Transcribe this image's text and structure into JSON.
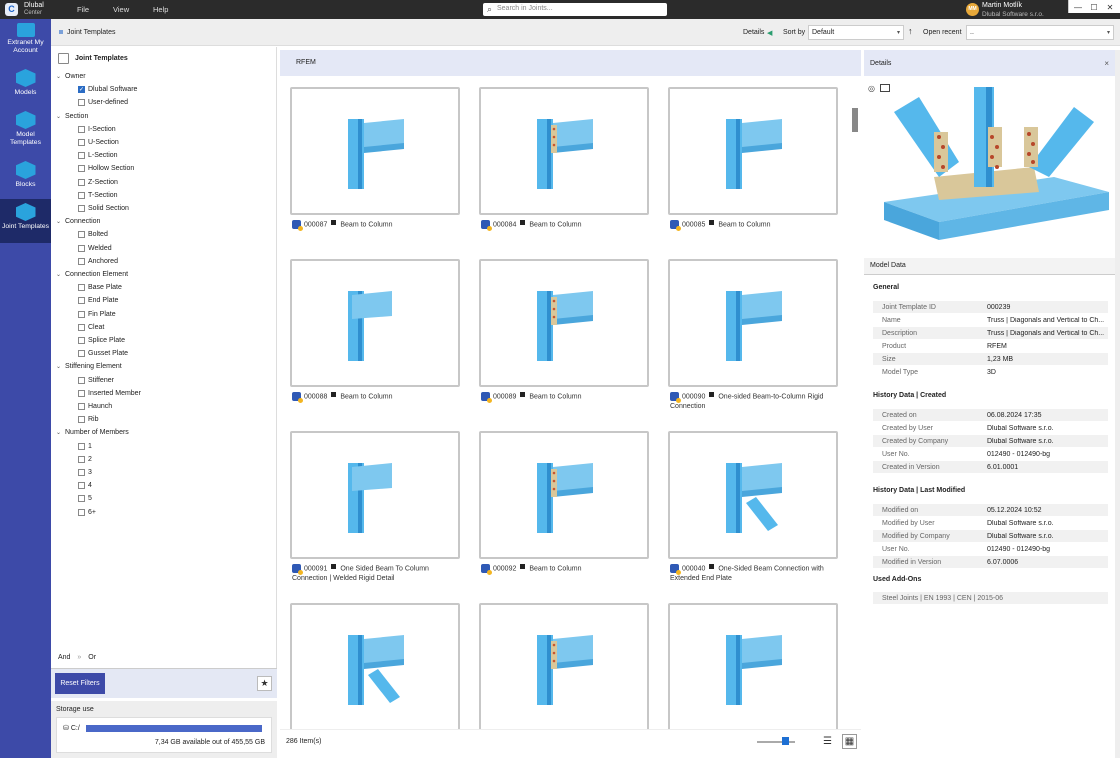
{
  "app": {
    "brand_top": "Dlubal",
    "brand_sub": "Center",
    "logo": "C"
  },
  "menu": [
    "File",
    "View",
    "Help"
  ],
  "search": {
    "placeholder": "Search in Joints..."
  },
  "user": {
    "initials": "MM",
    "name": "Martin Motlík",
    "company": "Dlubal Software s.r.o."
  },
  "window_controls": {
    "minimize": "—",
    "maximize": "☐",
    "close": "✕"
  },
  "nav": [
    {
      "label": "Extranet My Account",
      "icon": "extranet-icon"
    },
    {
      "label": "Models",
      "icon": "models-icon"
    },
    {
      "label": "Model Templates",
      "icon": "model-templates-icon"
    },
    {
      "label": "Blocks",
      "icon": "blocks-icon"
    },
    {
      "label": "Joint Templates",
      "icon": "joint-templates-icon",
      "selected": true
    }
  ],
  "toolbar": {
    "breadcrumb": "Joint Templates",
    "details_label": "Details",
    "sort_label": "Sort by",
    "sort_value": "Default",
    "open_recent_label": "Open recent",
    "open_recent_value": "..",
    "sort_dir_icon": "↑",
    "details_flag": "◀"
  },
  "filters": {
    "title": "Joint Templates",
    "groups": [
      {
        "label": "Owner",
        "items": [
          {
            "label": "Dlubal Software",
            "checked": true
          },
          {
            "label": "User-defined",
            "checked": false
          }
        ]
      },
      {
        "label": "Section",
        "items": [
          {
            "label": "I-Section"
          },
          {
            "label": "U-Section"
          },
          {
            "label": "L-Section"
          },
          {
            "label": "Hollow Section"
          },
          {
            "label": "Z-Section"
          },
          {
            "label": "T-Section"
          },
          {
            "label": "Solid Section"
          }
        ]
      },
      {
        "label": "Connection",
        "items": [
          {
            "label": "Bolted"
          },
          {
            "label": "Welded"
          },
          {
            "label": "Anchored"
          }
        ]
      },
      {
        "label": "Connection Element",
        "items": [
          {
            "label": "Base Plate"
          },
          {
            "label": "End Plate"
          },
          {
            "label": "Fin Plate"
          },
          {
            "label": "Cleat"
          },
          {
            "label": "Splice Plate"
          },
          {
            "label": "Gusset Plate"
          }
        ]
      },
      {
        "label": "Stiffening Element",
        "items": [
          {
            "label": "Stiffener"
          },
          {
            "label": "Inserted Member"
          },
          {
            "label": "Haunch"
          },
          {
            "label": "Rib"
          }
        ]
      },
      {
        "label": "Number of Members",
        "items": [
          {
            "label": "1"
          },
          {
            "label": "2"
          },
          {
            "label": "3"
          },
          {
            "label": "4"
          },
          {
            "label": "5"
          },
          {
            "label": "6+"
          }
        ]
      }
    ],
    "and_label": "And",
    "or_label": "Or",
    "reset_label": "Reset Filters"
  },
  "storage": {
    "title": "Storage use",
    "drive": "C:/",
    "available": "7,34 GB available out of 455,55 GB",
    "used_fraction": 0.984
  },
  "grid": {
    "header": "RFEM",
    "count": "286 Item(s)",
    "items": [
      {
        "id": "000087",
        "name": "Beam to Column"
      },
      {
        "id": "000084",
        "name": "Beam to Column"
      },
      {
        "id": "000085",
        "name": "Beam to Column"
      },
      {
        "id": "000088",
        "name": "Beam to Column"
      },
      {
        "id": "000089",
        "name": "Beam to Column"
      },
      {
        "id": "000090",
        "name": "One-sided Beam-to-Column Rigid Connection"
      },
      {
        "id": "000091",
        "name": "One Sided Beam To Column Connection | Welded Rigid Detail"
      },
      {
        "id": "000092",
        "name": "Beam to Column"
      },
      {
        "id": "000040",
        "name": "One-Sided Beam Connection with Extended End Plate"
      },
      {
        "id": "",
        "name": ""
      },
      {
        "id": "",
        "name": ""
      },
      {
        "id": "",
        "name": ""
      }
    ]
  },
  "details": {
    "title": "Details",
    "close": "×",
    "model_data_label": "Model Data",
    "general": {
      "title": "General",
      "rows": [
        [
          "Joint Template ID",
          "000239"
        ],
        [
          "Name",
          "Truss | Diagonals and Vertical to Ch..."
        ],
        [
          "Description",
          "Truss | Diagonals and Vertical to Ch..."
        ],
        [
          "Product",
          "RFEM"
        ],
        [
          "Size",
          "1,23 MB"
        ],
        [
          "Model Type",
          "3D"
        ]
      ]
    },
    "created": {
      "title": "History Data | Created",
      "rows": [
        [
          "Created on",
          "06.08.2024 17:35"
        ],
        [
          "Created by User",
          "Dlubal Software s.r.o."
        ],
        [
          "Created by Company",
          "Dlubal Software s.r.o."
        ],
        [
          "User No.",
          "012490 - 012490-bg"
        ],
        [
          "Created in Version",
          "6.01.0001"
        ]
      ]
    },
    "modified": {
      "title": "History Data | Last Modified",
      "rows": [
        [
          "Modified on",
          "05.12.2024 10:52"
        ],
        [
          "Modified by User",
          "Dlubal Software s.r.o."
        ],
        [
          "Modified by Company",
          "Dlubal Software s.r.o."
        ],
        [
          "User No.",
          "012490 - 012490-bg"
        ],
        [
          "Modified in Version",
          "6.07.0006"
        ]
      ]
    },
    "addons": {
      "title": "Used Add-Ons",
      "value": "Steel Joints | EN 1993 | CEN | 2015-06"
    }
  },
  "colors": {
    "nav": "#3d4aa8",
    "steel": "#55b8ec",
    "plate": "#d9c79a",
    "accent": "#2b6cc4"
  }
}
